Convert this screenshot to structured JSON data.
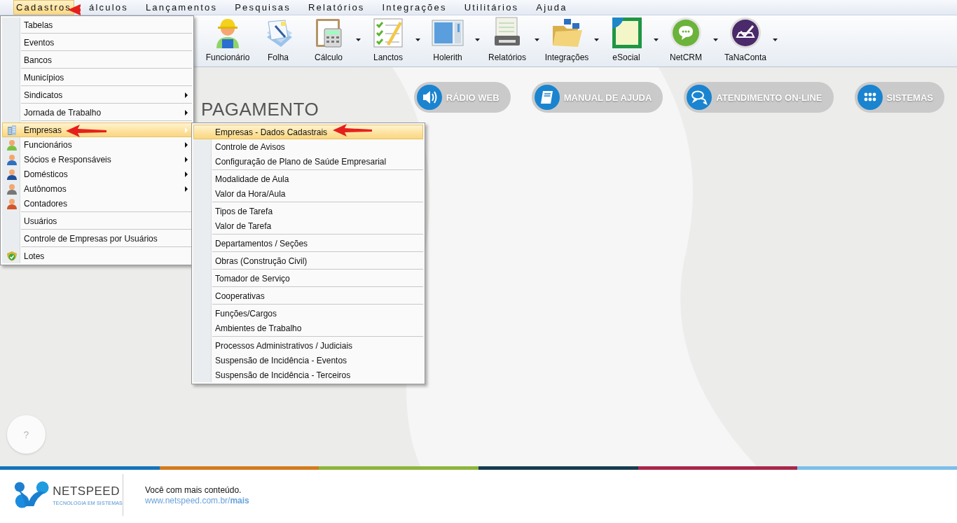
{
  "menubar": [
    {
      "label": "Cadastros",
      "selected": true
    },
    {
      "label": "álculos",
      "selected": false
    },
    {
      "label": "Lançamentos",
      "selected": false
    },
    {
      "label": "Pesquisas",
      "selected": false
    },
    {
      "label": "Relatórios",
      "selected": false
    },
    {
      "label": "Integrações",
      "selected": false
    },
    {
      "label": "Utilitários",
      "selected": false
    },
    {
      "label": "Ajuda",
      "selected": false
    }
  ],
  "toolbar": [
    {
      "label": "Funcionário",
      "kind": "worker",
      "dropdown": false
    },
    {
      "label": "Folha",
      "kind": "sheets",
      "dropdown": false
    },
    {
      "label": "Cálculo",
      "kind": "calculator",
      "dropdown": true
    },
    {
      "label": "Lanctos",
      "kind": "checklist",
      "dropdown": true
    },
    {
      "label": "Holerith",
      "kind": "window",
      "dropdown": true
    },
    {
      "label": "Relatórios",
      "kind": "printer",
      "dropdown": true
    },
    {
      "label": "Integrações",
      "kind": "folder",
      "dropdown": true
    },
    {
      "label": "eSocial",
      "kind": "esocial",
      "dropdown": true
    },
    {
      "label": "NetCRM",
      "kind": "chat",
      "dropdown": true
    },
    {
      "label": "TaNaConta",
      "kind": "check",
      "dropdown": true
    }
  ],
  "menu": [
    {
      "label": "Tabelas",
      "submenu": false,
      "selected": false,
      "separator_after": true
    },
    {
      "label": "Eventos",
      "submenu": false,
      "selected": false,
      "separator_after": true
    },
    {
      "label": "Bancos",
      "submenu": false,
      "selected": false,
      "separator_after": true
    },
    {
      "label": "Municípios",
      "submenu": false,
      "selected": false,
      "separator_after": true
    },
    {
      "label": "Sindicatos",
      "submenu": true,
      "selected": false,
      "separator_after": true
    },
    {
      "label": "Jornada de Trabalho",
      "submenu": true,
      "selected": false,
      "separator_after": true
    },
    {
      "label": "Empresas",
      "kind": "building",
      "submenu": true,
      "selected": true,
      "separator_after": false
    },
    {
      "label": "Funcionários",
      "kind": "person",
      "color": "#7cc242",
      "submenu": true,
      "selected": false,
      "separator_after": false
    },
    {
      "label": "Sócios e Responsáveis",
      "kind": "person",
      "color": "#2f6fc0",
      "submenu": true,
      "selected": false,
      "separator_after": false
    },
    {
      "label": "Domésticos",
      "kind": "person",
      "color": "#1f4f9a",
      "submenu": true,
      "selected": false,
      "separator_after": false
    },
    {
      "label": "Autônomos",
      "kind": "person",
      "color": "#777777",
      "submenu": true,
      "selected": false,
      "separator_after": false
    },
    {
      "label": "Contadores",
      "kind": "person",
      "color": "#d2552a",
      "submenu": false,
      "selected": false,
      "separator_after": true
    },
    {
      "label": "Usuários",
      "submenu": false,
      "selected": false,
      "separator_after": true
    },
    {
      "label": "Controle de Empresas por Usuários",
      "submenu": false,
      "selected": false,
      "separator_after": true
    },
    {
      "label": "Lotes",
      "kind": "shield",
      "submenu": false,
      "selected": false,
      "separator_after": false
    }
  ],
  "submenu": [
    {
      "label": "Empresas - Dados Cadastrais",
      "selected": true,
      "separator_after": false
    },
    {
      "label": "Controle de Avisos",
      "selected": false,
      "separator_after": false
    },
    {
      "label": "Configuração de Plano de Saúde Empresarial",
      "selected": false,
      "separator_after": true
    },
    {
      "label": "Modalidade de Aula",
      "selected": false,
      "separator_after": false
    },
    {
      "label": "Valor da Hora/Aula",
      "selected": false,
      "separator_after": true
    },
    {
      "label": "Tipos de Tarefa",
      "selected": false,
      "separator_after": false
    },
    {
      "label": "Valor de Tarefa",
      "selected": false,
      "separator_after": true
    },
    {
      "label": "Departamentos / Seções",
      "selected": false,
      "separator_after": true
    },
    {
      "label": "Obras (Construção Civil)",
      "selected": false,
      "separator_after": true
    },
    {
      "label": "Tomador de Serviço",
      "selected": false,
      "separator_after": true
    },
    {
      "label": "Cooperativas",
      "selected": false,
      "separator_after": true
    },
    {
      "label": "Funções/Cargos",
      "selected": false,
      "separator_after": false
    },
    {
      "label": "Ambientes de Trabalho",
      "selected": false,
      "separator_after": true
    },
    {
      "label": "Processos Administrativos / Judiciais",
      "selected": false,
      "separator_after": false
    },
    {
      "label": "Suspensão de Incidência - Eventos",
      "selected": false,
      "separator_after": false
    },
    {
      "label": "Suspensão de Incidência - Terceiros",
      "selected": false,
      "separator_after": false
    }
  ],
  "main": {
    "heading": "PAGAMENTO",
    "quick_links": [
      {
        "label": "RÁDIO WEB",
        "kind": "speaker"
      },
      {
        "label": "MANUAL DE AJUDA",
        "kind": "book"
      },
      {
        "label": "ATENDIMENTO ON-LINE",
        "kind": "chat"
      },
      {
        "label": "SISTEMAS",
        "kind": "grid"
      }
    ],
    "help_button": "?"
  },
  "footer": {
    "brand": "NETSPEED",
    "tagline": "TECNOLOGIA EM SISTEMAS",
    "text": "Você com mais conteúdo.",
    "link": "www.netspeed.com.br/**mais**"
  }
}
